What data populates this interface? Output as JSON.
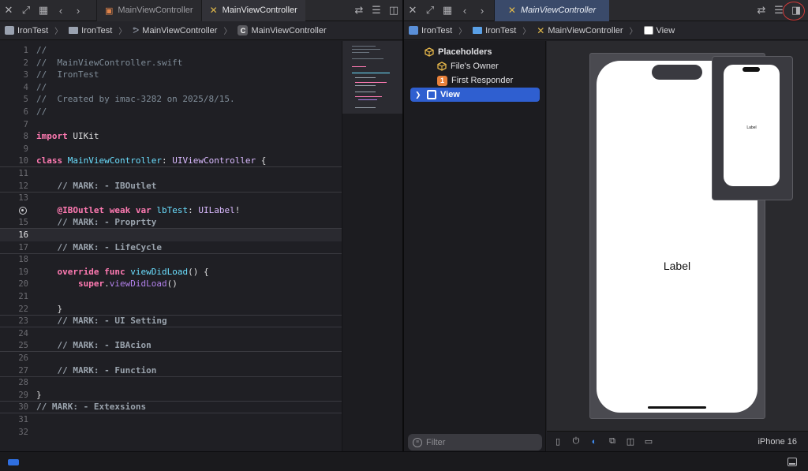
{
  "left_editor": {
    "tabs": [
      {
        "label": "MainViewController",
        "state": "inactive"
      },
      {
        "label": "MainViewController",
        "state": "active"
      }
    ],
    "breadcrumb": [
      "IronTest",
      "IronTest",
      "MainViewController",
      "MainViewController"
    ],
    "lines": [
      {
        "n": "1",
        "tokens": [
          {
            "t": "//",
            "c": "comment"
          }
        ]
      },
      {
        "n": "2",
        "tokens": [
          {
            "t": "//  MainViewController.swift",
            "c": "comment"
          }
        ]
      },
      {
        "n": "3",
        "tokens": [
          {
            "t": "//  IronTest",
            "c": "comment"
          }
        ]
      },
      {
        "n": "4",
        "tokens": [
          {
            "t": "//",
            "c": "comment"
          }
        ]
      },
      {
        "n": "5",
        "tokens": [
          {
            "t": "//  Created by imac-3282 on 2025/8/15.",
            "c": "comment"
          }
        ]
      },
      {
        "n": "6",
        "tokens": [
          {
            "t": "//",
            "c": "comment"
          }
        ]
      },
      {
        "n": "7",
        "tokens": []
      },
      {
        "n": "8",
        "tokens": [
          {
            "t": "import",
            "c": "kw"
          },
          {
            "t": " UIKit",
            "c": "plain"
          }
        ]
      },
      {
        "n": "9",
        "tokens": []
      },
      {
        "n": "10",
        "tokens": [
          {
            "t": "class",
            "c": "kw"
          },
          {
            "t": " ",
            "c": "plain"
          },
          {
            "t": "MainViewController",
            "c": "decl"
          },
          {
            "t": ": ",
            "c": "plain"
          },
          {
            "t": "UIViewController",
            "c": "type"
          },
          {
            "t": " {",
            "c": "plain"
          }
        ],
        "mark": true
      },
      {
        "n": "11",
        "tokens": []
      },
      {
        "n": "12",
        "tokens": [
          {
            "t": "    // MARK: - IBOutlet",
            "c": "mark"
          }
        ],
        "mark": true
      },
      {
        "n": "13",
        "tokens": []
      },
      {
        "n": "14",
        "tokens": [
          {
            "t": "    ",
            "c": "plain"
          },
          {
            "t": "@IBOutlet",
            "c": "kw"
          },
          {
            "t": " ",
            "c": "plain"
          },
          {
            "t": "weak",
            "c": "kw"
          },
          {
            "t": " ",
            "c": "plain"
          },
          {
            "t": "var",
            "c": "kw"
          },
          {
            "t": " ",
            "c": "plain"
          },
          {
            "t": "lbTest",
            "c": "decl"
          },
          {
            "t": ": ",
            "c": "plain"
          },
          {
            "t": "UILabel",
            "c": "type"
          },
          {
            "t": "!",
            "c": "plain"
          }
        ],
        "outlet": true,
        "hide_number": true
      },
      {
        "n": "15",
        "tokens": [
          {
            "t": "    // MARK: - Proprtty",
            "c": "mark"
          }
        ],
        "mark": true
      },
      {
        "n": "16",
        "tokens": [],
        "current": true
      },
      {
        "n": "17",
        "tokens": [
          {
            "t": "    // MARK: - LifeCycle",
            "c": "mark"
          }
        ],
        "mark": true
      },
      {
        "n": "18",
        "tokens": []
      },
      {
        "n": "19",
        "tokens": [
          {
            "t": "    ",
            "c": "plain"
          },
          {
            "t": "override",
            "c": "kw"
          },
          {
            "t": " ",
            "c": "plain"
          },
          {
            "t": "func",
            "c": "kw"
          },
          {
            "t": " ",
            "c": "plain"
          },
          {
            "t": "viewDidLoad",
            "c": "decl"
          },
          {
            "t": "() {",
            "c": "plain"
          }
        ]
      },
      {
        "n": "20",
        "tokens": [
          {
            "t": "        ",
            "c": "plain"
          },
          {
            "t": "super",
            "c": "kw"
          },
          {
            "t": ".",
            "c": "plain"
          },
          {
            "t": "viewDidLoad",
            "c": "fn"
          },
          {
            "t": "()",
            "c": "plain"
          }
        ]
      },
      {
        "n": "21",
        "tokens": []
      },
      {
        "n": "22",
        "tokens": [
          {
            "t": "    }",
            "c": "plain"
          }
        ],
        "mark": true
      },
      {
        "n": "23",
        "tokens": [
          {
            "t": "    // MARK: - UI Setting",
            "c": "mark"
          }
        ],
        "mark": true
      },
      {
        "n": "24",
        "tokens": []
      },
      {
        "n": "25",
        "tokens": [
          {
            "t": "    // MARK: - IBAcion",
            "c": "mark"
          }
        ],
        "mark": true
      },
      {
        "n": "26",
        "tokens": []
      },
      {
        "n": "27",
        "tokens": [
          {
            "t": "    // MARK: - Function",
            "c": "mark"
          }
        ],
        "mark": true
      },
      {
        "n": "28",
        "tokens": []
      },
      {
        "n": "29",
        "tokens": [
          {
            "t": "}",
            "c": "plain"
          }
        ],
        "mark": true
      },
      {
        "n": "30",
        "tokens": [
          {
            "t": "// MARK: - Extexsions",
            "c": "mark"
          }
        ],
        "mark": true
      },
      {
        "n": "31",
        "tokens": []
      },
      {
        "n": "32",
        "tokens": []
      }
    ]
  },
  "right_editor": {
    "tab": {
      "label": "MainViewController"
    },
    "breadcrumb": [
      "IronTest",
      "IronTest",
      "MainViewController",
      "View"
    ],
    "outline": {
      "section": "Placeholders",
      "items": [
        "File's Owner",
        "First Responder"
      ],
      "badge": "1",
      "selected": "View"
    },
    "filter_placeholder": "Filter",
    "canvas": {
      "label_text": "Label",
      "preview_label_text": "Label",
      "device": "iPhone 16"
    }
  },
  "colors": {
    "accent": "#2f5fd0",
    "keyword": "#ff7ab2",
    "type": "#dabaff",
    "comment": "#7f8c98"
  }
}
